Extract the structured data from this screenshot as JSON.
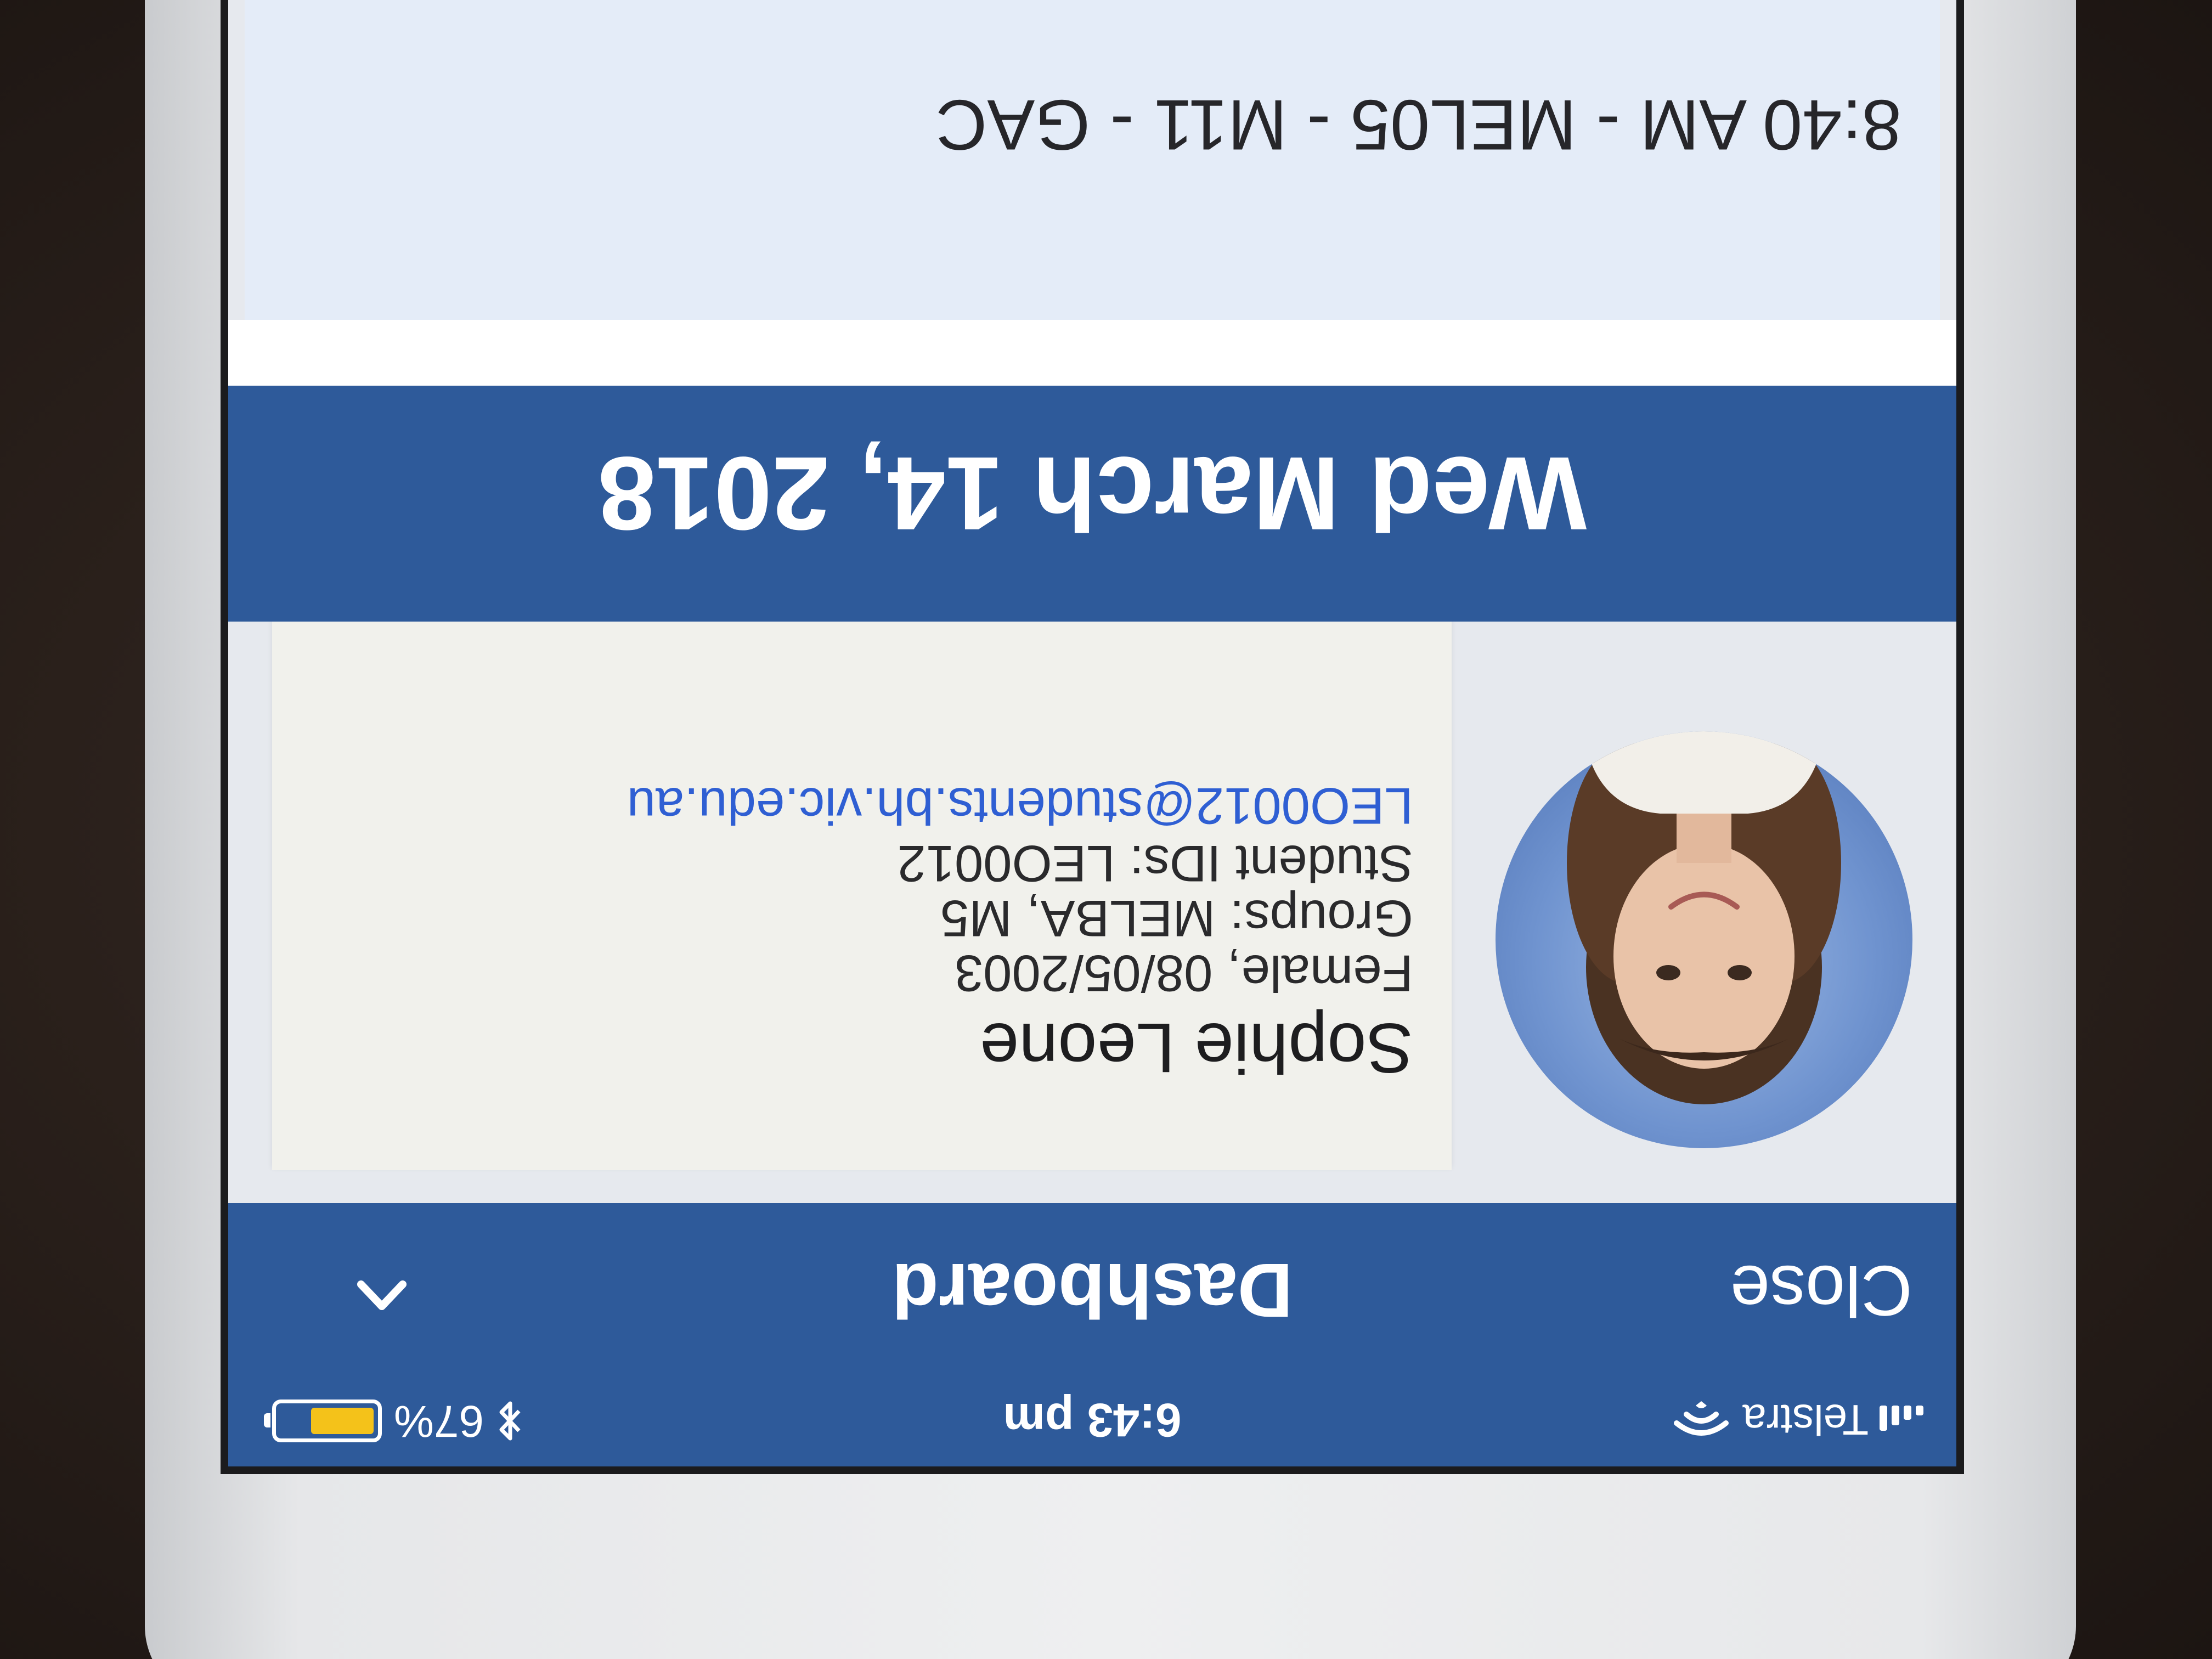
{
  "status_bar": {
    "carrier": "Telstra",
    "time": "6:43 pm",
    "bluetooth_icon": "bluetooth-icon",
    "battery_percent": "67%",
    "battery_level": 0.67,
    "battery_color": "#f4c21a"
  },
  "nav": {
    "close_label": "Close",
    "title": "Dashboard",
    "chevron_icon": "chevron-up-icon"
  },
  "student": {
    "name": "Sophie Leone",
    "gender_dob": "Female, 08/05/2003",
    "groups": "Groups: MELBA, M5",
    "student_ids": "Student IDs: LEO0012",
    "email": "LEO0012@students.bh.vic.edu.au"
  },
  "schedule": {
    "date": "Wed March 14, 2018",
    "lessons": [
      {
        "text": "8:40 AM - MEL05 - M11 - GAC"
      }
    ]
  },
  "colors": {
    "header_blue": "#2e5a9a",
    "link_blue": "#2f5fd3",
    "card_bg": "#f1f1ec",
    "lesson_bg": "#e4ecf8"
  }
}
